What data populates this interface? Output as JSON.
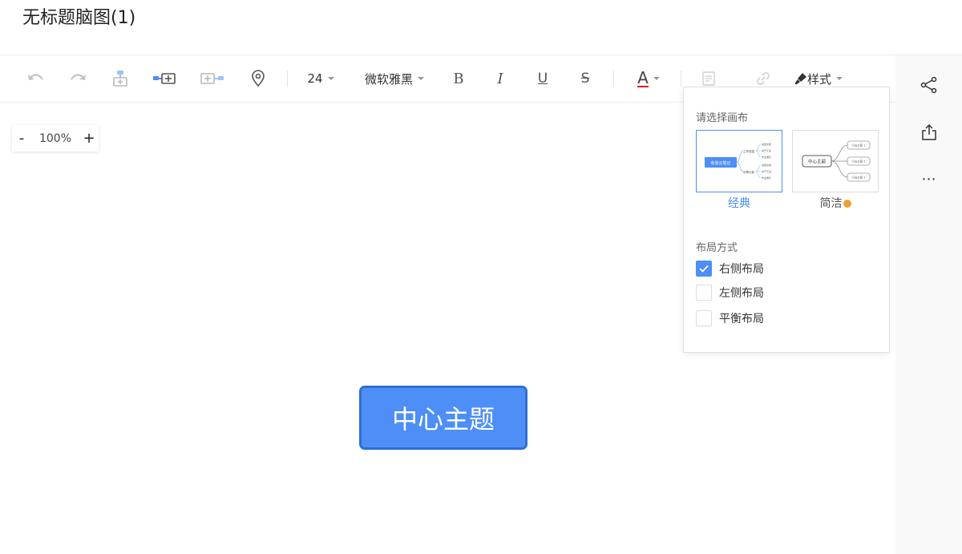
{
  "document": {
    "title": "无标题脑图(1)"
  },
  "toolbar": {
    "font_size": "24",
    "font_family": "微软雅黑",
    "bold": "B",
    "italic": "I",
    "underline": "U",
    "strike": "S",
    "font_color": "A",
    "font_color_value": "#e02020",
    "style_label": "样式",
    "icons": [
      "undo-icon",
      "redo-icon",
      "insert-child-above-icon",
      "insert-sibling-icon",
      "insert-child-icon",
      "location-pin-icon",
      "note-icon",
      "link-icon",
      "brush-icon"
    ]
  },
  "zoom": {
    "minus": "-",
    "value": "100%",
    "plus": "+"
  },
  "canvas": {
    "center_topic": "中心主题"
  },
  "right_rail": {
    "icons": [
      "share-icon",
      "export-icon",
      "more-icon"
    ],
    "more_label": "⋯"
  },
  "style_panel": {
    "canvas_heading": "请选择画布",
    "themes": [
      {
        "label": "经典",
        "selected": true,
        "preview": {
          "root": "有道云笔记",
          "branches": [
            "工作总结",
            "分享计划"
          ],
          "leaves": [
            "总结文档",
            "资产汇总",
            "作业展示",
            "总结文档",
            "资产汇总",
            "作业展示"
          ]
        }
      },
      {
        "label": "简洁",
        "selected": false,
        "vip": true,
        "preview": {
          "root": "中心主题",
          "leaves": [
            "分支主题 1",
            "分支主题 2",
            "分支主题 3"
          ]
        }
      }
    ],
    "layout_heading": "布局方式",
    "layouts": [
      {
        "label": "右侧布局",
        "checked": true
      },
      {
        "label": "左侧布局",
        "checked": false
      },
      {
        "label": "平衡布局",
        "checked": false
      }
    ]
  },
  "colors": {
    "accent": "#4d8ef7",
    "accent_dark": "#2f6fd6",
    "vip_badge": "#f0a030"
  }
}
